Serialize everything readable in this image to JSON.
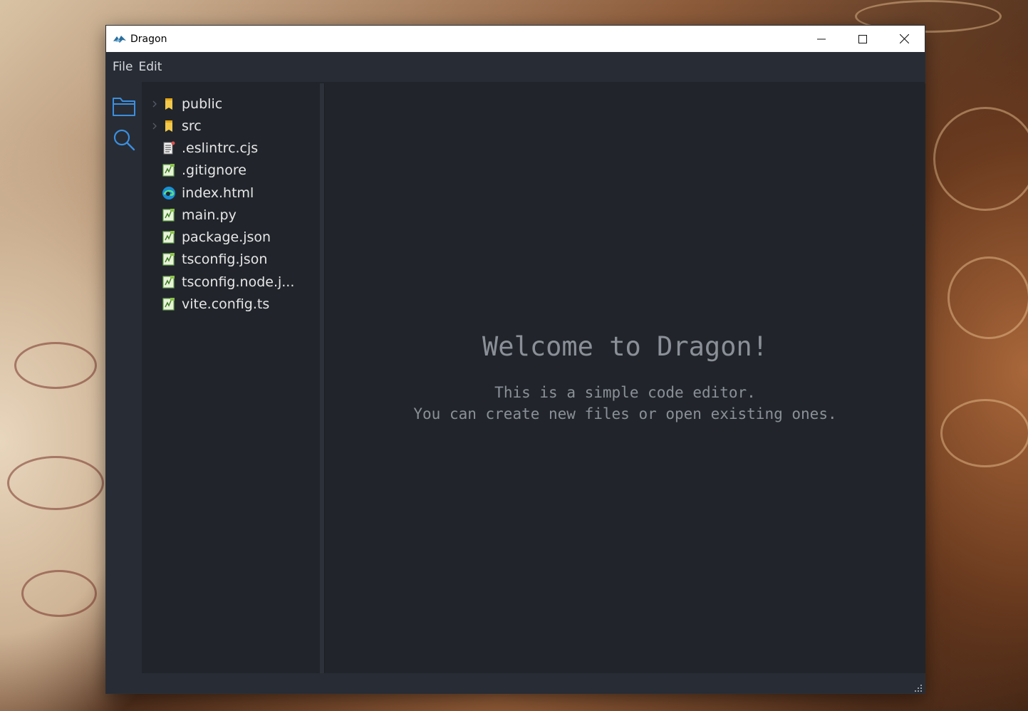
{
  "window": {
    "title": "Dragon",
    "controls": [
      "minimize-icon",
      "maximize-icon",
      "close-icon"
    ]
  },
  "menu": {
    "items": [
      "File",
      "Edit"
    ]
  },
  "activity_bar": {
    "icons": [
      "folder-icon",
      "search-icon"
    ],
    "accent_color": "#3b8fe0"
  },
  "explorer": {
    "items": [
      {
        "label": "public",
        "type": "folder",
        "icon": "folder-icon"
      },
      {
        "label": "src",
        "type": "folder",
        "icon": "folder-icon"
      },
      {
        "label": ".eslintrc.cjs",
        "type": "file",
        "icon": "script-file-icon"
      },
      {
        "label": ".gitignore",
        "type": "file",
        "icon": "text-file-icon"
      },
      {
        "label": "index.html",
        "type": "file",
        "icon": "edge-browser-icon"
      },
      {
        "label": "main.py",
        "type": "file",
        "icon": "text-file-icon"
      },
      {
        "label": "package.json",
        "type": "file",
        "icon": "text-file-icon"
      },
      {
        "label": "tsconfig.json",
        "type": "file",
        "icon": "text-file-icon"
      },
      {
        "label": "tsconfig.node.j...",
        "type": "file",
        "icon": "text-file-icon"
      },
      {
        "label": "vite.config.ts",
        "type": "file",
        "icon": "text-file-icon"
      }
    ]
  },
  "editor": {
    "welcome_title": "Welcome to Dragon!",
    "welcome_line1": "This is a simple code editor.",
    "welcome_line2": "You can create new files or open existing ones."
  },
  "colors": {
    "background": "#21252b",
    "panel": "#282c34",
    "text": "#e6e6e6",
    "muted_text": "#8b9098"
  }
}
